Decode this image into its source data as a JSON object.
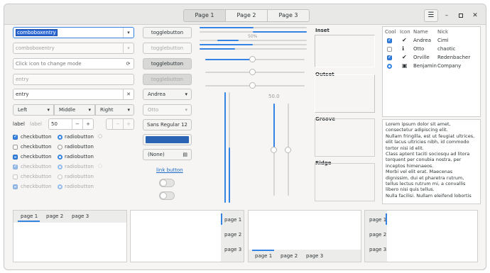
{
  "headerbar": {
    "tabs": [
      "Page 1",
      "Page 2",
      "Page 3"
    ],
    "menu_icon": "hamburger-icon",
    "minimize_icon": "minimize-icon",
    "maximize_icon": "maximize-icon",
    "close_icon": "close-icon"
  },
  "column1": {
    "combobox_entry_value": "comboboxentry",
    "combobox_entry_disabled_value": "comboboxentry",
    "mode_entry_placeholder": "Click icon to change mode",
    "entry_disabled_placeholder": "entry",
    "entry_value": "entry",
    "align_buttons": [
      "Left",
      "Middle",
      "Right"
    ],
    "spin_label": "label",
    "spin_label_disabled": "label",
    "spin_value": "50",
    "spin_minus": "−",
    "spin_plus": "+",
    "checkbuttons": [
      {
        "label": "checkbutton",
        "state": "checked"
      },
      {
        "label": "checkbutton",
        "state": "unchecked"
      },
      {
        "label": "checkbutton",
        "state": "mixed"
      },
      {
        "label": "checkbutton",
        "state": "checked",
        "disabled": true
      },
      {
        "label": "checkbutton",
        "state": "unchecked",
        "disabled": true
      },
      {
        "label": "checkbutton",
        "state": "mixed",
        "disabled": true
      }
    ],
    "radiobuttons": [
      {
        "label": "radiobutton",
        "state": "checked"
      },
      {
        "label": "radiobutton",
        "state": "unchecked"
      },
      {
        "label": "radiobutton",
        "state": "mixed"
      },
      {
        "label": "radiobutton",
        "state": "checked",
        "disabled": true
      },
      {
        "label": "radiobutton",
        "state": "unchecked",
        "disabled": true
      },
      {
        "label": "radiobutton",
        "state": "mixed",
        "disabled": true
      }
    ]
  },
  "column2": {
    "togglebuttons": [
      "togglebutton",
      "togglebutton",
      "togglebutton",
      "togglebutton"
    ],
    "combo_andrea": "Andrea",
    "combo_otto": "Otto",
    "font_button": {
      "name": "Sans Regular",
      "size": "12"
    },
    "color_button_color": "#2a62b4",
    "file_button": "(None)",
    "link_button": "link button",
    "switches": [
      {
        "on": false
      },
      {
        "on": false
      }
    ]
  },
  "sliders": {
    "progress_label": "50%",
    "progress_values": [
      0.5,
      0.25,
      0.5
    ],
    "scale_value_label": "50.0",
    "hscale_values": [
      0.5,
      0.5,
      0.5
    ],
    "vscale_values": [
      1.0,
      0.5,
      0.5
    ]
  },
  "frames": [
    "Inset",
    "Outset",
    "Groove",
    "Ridge"
  ],
  "list": {
    "columns": [
      "Cool",
      "Icon",
      "Name",
      "Nick"
    ],
    "rows": [
      {
        "cool": "checked",
        "icon": "check-circle-icon",
        "name": "Andrea",
        "nick": "Cimi"
      },
      {
        "cool": "unchecked",
        "icon": "info-icon",
        "name": "Otto",
        "nick": "chaotic"
      },
      {
        "cool": "checked",
        "icon": "check-circle-icon",
        "name": "Orville",
        "nick": "Redenbacher"
      },
      {
        "cool": "radio",
        "icon": "building-icon",
        "name": "Benjamin",
        "nick": "Company"
      }
    ]
  },
  "textview": {
    "lines": [
      "Lorem ipsum dolor sit amet,",
      "consectetur adipiscing elit.",
      "Nullam fringilla, est ut feugiat ultrices,",
      "elit lacus ultricies nibh, id commodo",
      "tortor nisi id elit.",
      "Class aptent taciti sociosqu ad litora",
      "torquent per conubia nostra, per",
      "inceptos himenaeos.",
      "Morbi vel elit erat. Maecenas",
      "dignissim, dui et pharetra rutrum,",
      "tellus lectus rutrum mi, a convallis",
      "libero nisi quis tellus.",
      "Nulla facilisi. Nullam eleifend lobortis"
    ]
  },
  "notebooks": {
    "nb1_tabs": [
      "page 1",
      "page 2",
      "page 3"
    ],
    "nb2_tabs": [
      "page 1",
      "page 2",
      "page 3"
    ],
    "nb3_tabs": [
      "page 1",
      "page 2",
      "page 3"
    ],
    "nb4_tabs": [
      "page 1",
      "page 2",
      "page 3"
    ]
  },
  "colors": {
    "accent": "#3584e4",
    "headerbar": "#e8e8e7",
    "window": "#f6f5f4"
  }
}
